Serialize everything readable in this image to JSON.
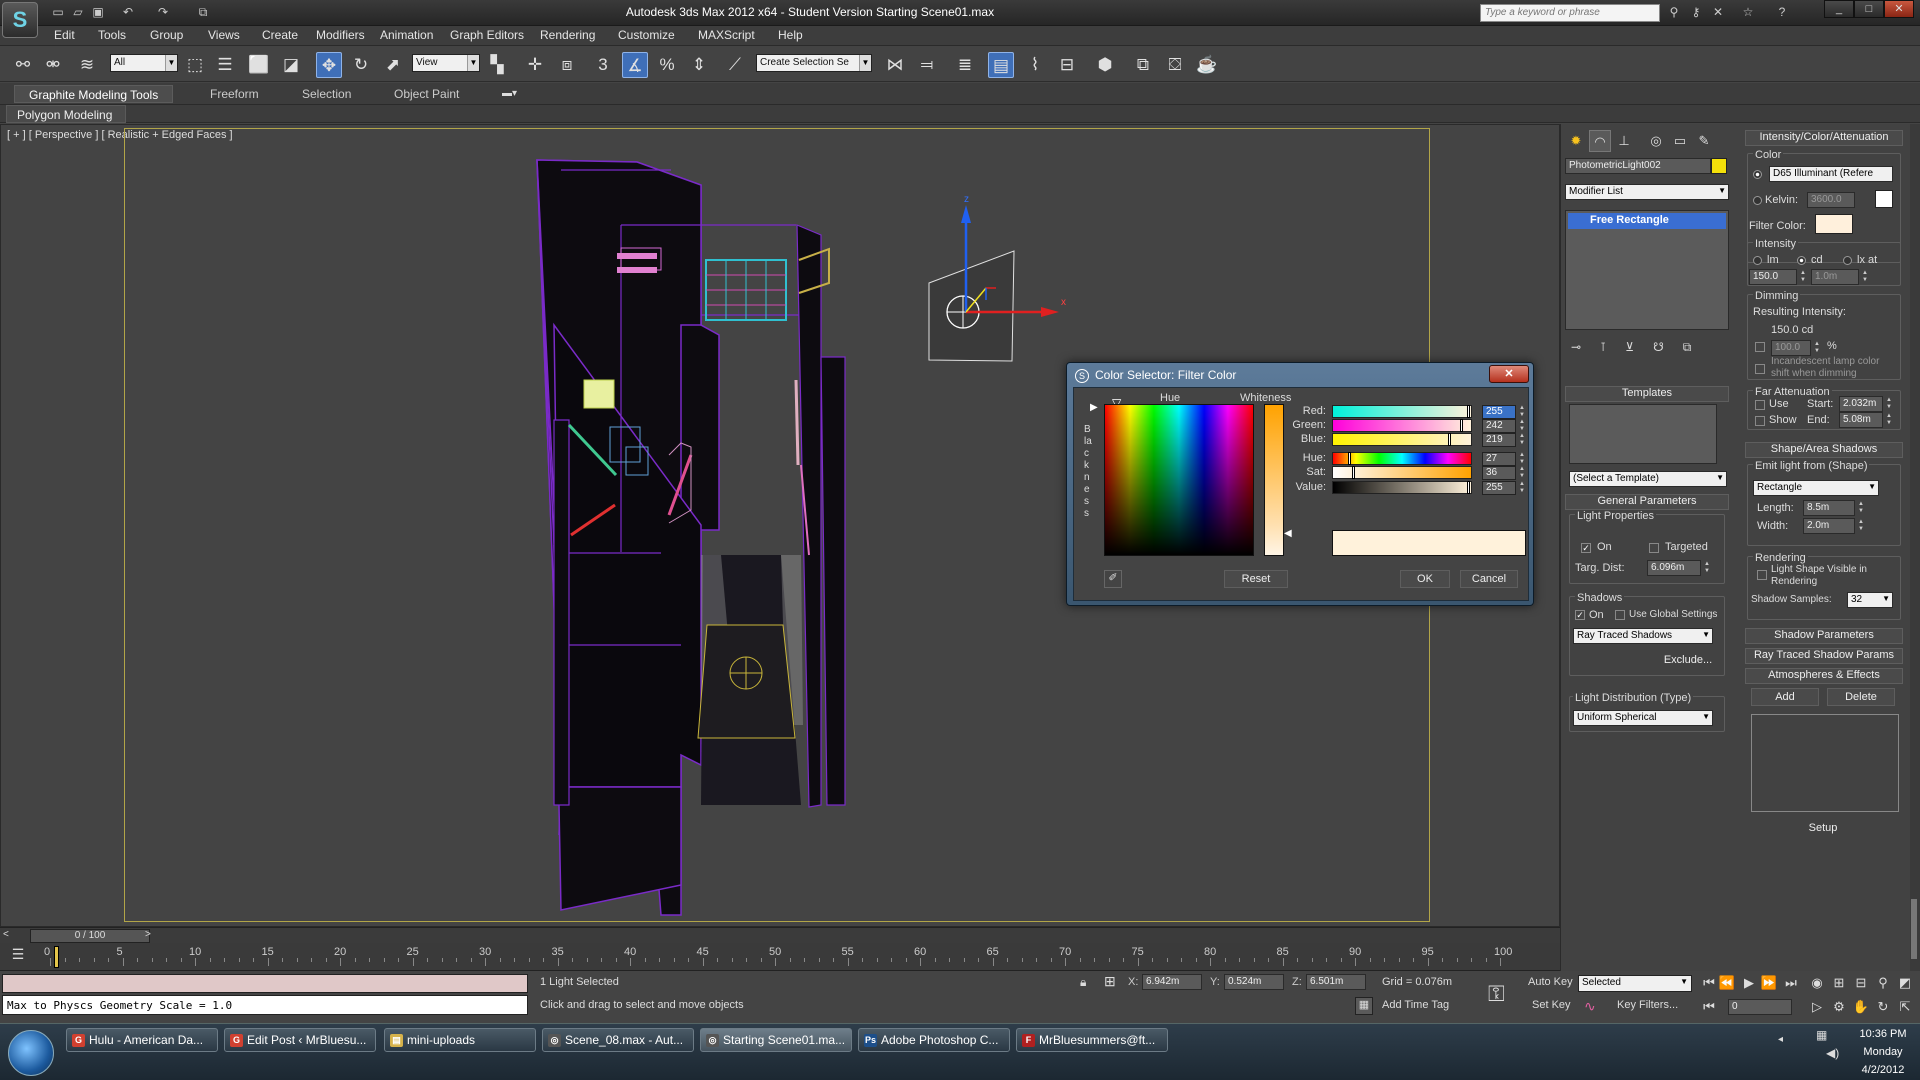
{
  "window": {
    "title": "Autodesk 3ds Max  2012 x64  -  Student Version    Starting Scene01.max",
    "search_placeholder": "Type a keyword or phrase",
    "controls": [
      "_",
      "□",
      "✕"
    ]
  },
  "menu": [
    "Edit",
    "Tools",
    "Group",
    "Views",
    "Create",
    "Modifiers",
    "Animation",
    "Graph Editors",
    "Rendering",
    "Customize",
    "MAXScript",
    "Help"
  ],
  "toolbar": {
    "selection_filter": "All",
    "ref_coord": "View",
    "named_sel": "Create Selection Se",
    "angle_snap": "3",
    "percent": "%"
  },
  "ribbon": {
    "tabs": [
      "Graphite Modeling Tools",
      "Freeform",
      "Selection",
      "Object Paint"
    ],
    "sub": "Polygon Modeling"
  },
  "viewport": {
    "label": "[ + ] [ Perspective ] [ Realistic + Edged Faces ]",
    "gizmo_z": "z",
    "gizmo_x": "x"
  },
  "timeline": {
    "slider": "0 / 100",
    "ticks": [
      "0",
      "5",
      "10",
      "15",
      "20",
      "25",
      "30",
      "35",
      "40",
      "45",
      "50",
      "55",
      "60",
      "65",
      "70",
      "75",
      "80",
      "85",
      "90",
      "95",
      "100"
    ]
  },
  "status": {
    "maxscript": "Max to Physcs Geometry Scale = 1.0",
    "selection": "1 Light Selected",
    "prompt": "Click and drag to select and move objects",
    "x_label": "X:",
    "x": "6.942m",
    "y_label": "Y:",
    "y": "0.524m",
    "z_label": "Z:",
    "z": "6.501m",
    "grid": "Grid = 0.076m",
    "add_time_tag": "Add Time Tag",
    "auto_key": "Auto Key",
    "set_key": "Set Key",
    "key_mode": "Selected",
    "key_filters": "Key Filters...",
    "frame": "0"
  },
  "taskbar": {
    "items": [
      {
        "label": "Hulu - American Da...",
        "icon": "G",
        "color": "#d04030"
      },
      {
        "label": "Edit Post ‹ MrBluesu...",
        "icon": "G",
        "color": "#d04030"
      },
      {
        "label": "mini-uploads",
        "icon": "▤",
        "color": "#d6b24a"
      },
      {
        "label": "Scene_08.max - Aut...",
        "icon": "◎",
        "color": "#555"
      },
      {
        "label": "Starting Scene01.ma...",
        "icon": "◎",
        "color": "#555"
      },
      {
        "label": "Adobe Photoshop C...",
        "icon": "Ps",
        "color": "#1d4f8a"
      },
      {
        "label": "MrBluesummers@ft...",
        "icon": "F",
        "color": "#b02020"
      }
    ],
    "time": "10:36 PM",
    "day": "Monday",
    "date": "4/2/2012"
  },
  "command_panel": {
    "object_name": "PhotometricLight002",
    "object_color": "#f4e00a",
    "modifier_list": "Modifier List",
    "stack_item": "Free Rectangle",
    "templates_header": "Templates",
    "template_select": "(Select a Template)",
    "general_header": "General Parameters",
    "light_props": "Light Properties",
    "on_label": "On",
    "targeted_label": "Targeted",
    "targ_dist_label": "Targ. Dist:",
    "targ_dist": "6.096m",
    "shadows": "Shadows",
    "use_global": "Use Global Settings",
    "shadow_type": "Ray Traced Shadows",
    "exclude": "Exclude...",
    "light_dist": "Light Distribution (Type)",
    "dist_type": "Uniform Spherical"
  },
  "rollout": {
    "header": "Intensity/Color/Attenuation",
    "color_group": "Color",
    "illuminant": "D65 Illuminant (Refere",
    "kelvin_label": "Kelvin:",
    "kelvin": "3600.0",
    "filter_color_label": "Filter Color:",
    "filter_color": "#fff0dc",
    "intensity_group": "Intensity",
    "units": [
      "lm",
      "cd",
      "lx at"
    ],
    "intensity": "150.0",
    "lx_dist": "1.0m",
    "dimming_group": "Dimming",
    "resulting": "Resulting Intensity:",
    "resulting_val": "150.0 cd",
    "dim_pct": "100.0",
    "pct": "%",
    "incandescent": "Incandescent lamp color shift when dimming",
    "far_atten": "Far Attenuation",
    "use": "Use",
    "show": "Show",
    "start_label": "Start:",
    "start": "2.032m",
    "end_label": "End:",
    "end": "5.08m",
    "shape_header": "Shape/Area Shadows",
    "emit_label": "Emit light from (Shape)",
    "shape": "Rectangle",
    "length_label": "Length:",
    "length": "8.5m",
    "width_label": "Width:",
    "width": "2.0m",
    "rendering_group": "Rendering",
    "light_shape_visible": "Light Shape Visible in Rendering",
    "shadow_samples_label": "Shadow Samples:",
    "shadow_samples": "32",
    "shadow_params": "Shadow Parameters",
    "ray_traced_params": "Ray Traced Shadow Params",
    "atmos": "Atmospheres & Effects",
    "add": "Add",
    "delete": "Delete",
    "setup": "Setup"
  },
  "color_dialog": {
    "title": "Color Selector: Filter Color",
    "hue_label": "Hue",
    "whiteness_label": "Whiteness",
    "blackness_label": "Blackness",
    "channels": [
      {
        "label": "Red:",
        "value": "255",
        "fraction": 1.0
      },
      {
        "label": "Green:",
        "value": "242",
        "fraction": 0.95
      },
      {
        "label": "Blue:",
        "value": "219",
        "fraction": 0.86
      },
      {
        "label": "Hue:",
        "value": "27",
        "fraction": 0.11
      },
      {
        "label": "Sat:",
        "value": "36",
        "fraction": 0.14
      },
      {
        "label": "Value:",
        "value": "255",
        "fraction": 1.0
      }
    ],
    "swatch": "#fff2db",
    "reset": "Reset",
    "ok": "OK",
    "cancel": "Cancel"
  }
}
